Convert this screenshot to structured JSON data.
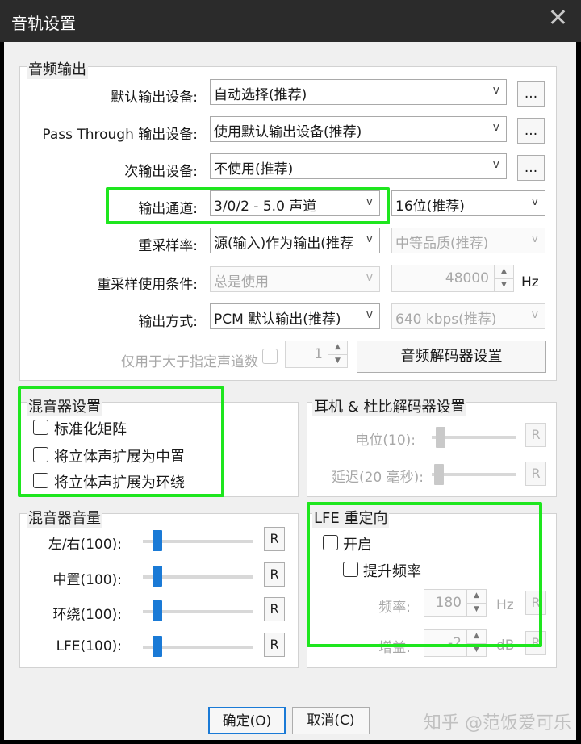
{
  "window": {
    "title": "音轨设置",
    "close_glyph": "✕"
  },
  "audio_output": {
    "legend": "音频输出",
    "default_device_label": "默认输出设备:",
    "default_device_value": "自动选择(推荐)",
    "passthrough_label": "Pass Through 输出设备:",
    "passthrough_value": "使用默认输出设备(推荐)",
    "secondary_label": "次输出设备:",
    "secondary_value": "不使用(推荐)",
    "browse_label": "...",
    "channels_label": "输出通道:",
    "channels_value": "3/0/2 - 5.0 声道",
    "bits_value": "16位(推荐)",
    "resample_label": "重采样率:",
    "resample_value": "源(输入)作为输出(推荐",
    "quality_value": "中等品质(推荐)",
    "resample_cond_label": "重采样使用条件:",
    "resample_cond_value": "总是使用",
    "sample_rate_value": "48000",
    "sample_rate_unit": "Hz",
    "output_mode_label": "输出方式:",
    "output_mode_value": "PCM 默认输出(推荐)",
    "bitrate_value": "640 kbps(推荐)",
    "only_channels_label": "仅用于大于指定声道数",
    "only_channels_value": "1",
    "decoder_button": "音频解码器设置"
  },
  "mixer_settings": {
    "legend": "混音器设置",
    "normalize": "标准化矩阵",
    "stereo_center": "将立体声扩展为中置",
    "stereo_surround": "将立体声扩展为环绕"
  },
  "headphone": {
    "legend": "耳机 & 杜比解码器设置",
    "level_label": "电位(10):",
    "delay_label": "延迟(20 毫秒):",
    "reset_label": "R"
  },
  "mixer_volume": {
    "legend": "混音器音量",
    "rows": [
      {
        "label": "左/右(100):",
        "value": 100
      },
      {
        "label": "中置(100):",
        "value": 100
      },
      {
        "label": "环绕(100):",
        "value": 100
      },
      {
        "label": "LFE(100):",
        "value": 100
      }
    ],
    "reset_label": "R"
  },
  "lfe": {
    "legend": "LFE 重定向",
    "enable": "开启",
    "boost": "提升频率",
    "freq_label": "频率:",
    "freq_value": "180",
    "freq_unit": "Hz",
    "gain_label": "增益:",
    "gain_value": "-2",
    "gain_unit": "dB",
    "reset_label": "R"
  },
  "footer": {
    "ok_button": "确定(O)",
    "cancel_button": "取消(C)",
    "watermark": "知乎 @范饭爱可乐"
  },
  "colors": {
    "highlight": "#1ee61e",
    "slider_thumb": "#1a7ad6",
    "titlebar": "#2b2b2b"
  }
}
